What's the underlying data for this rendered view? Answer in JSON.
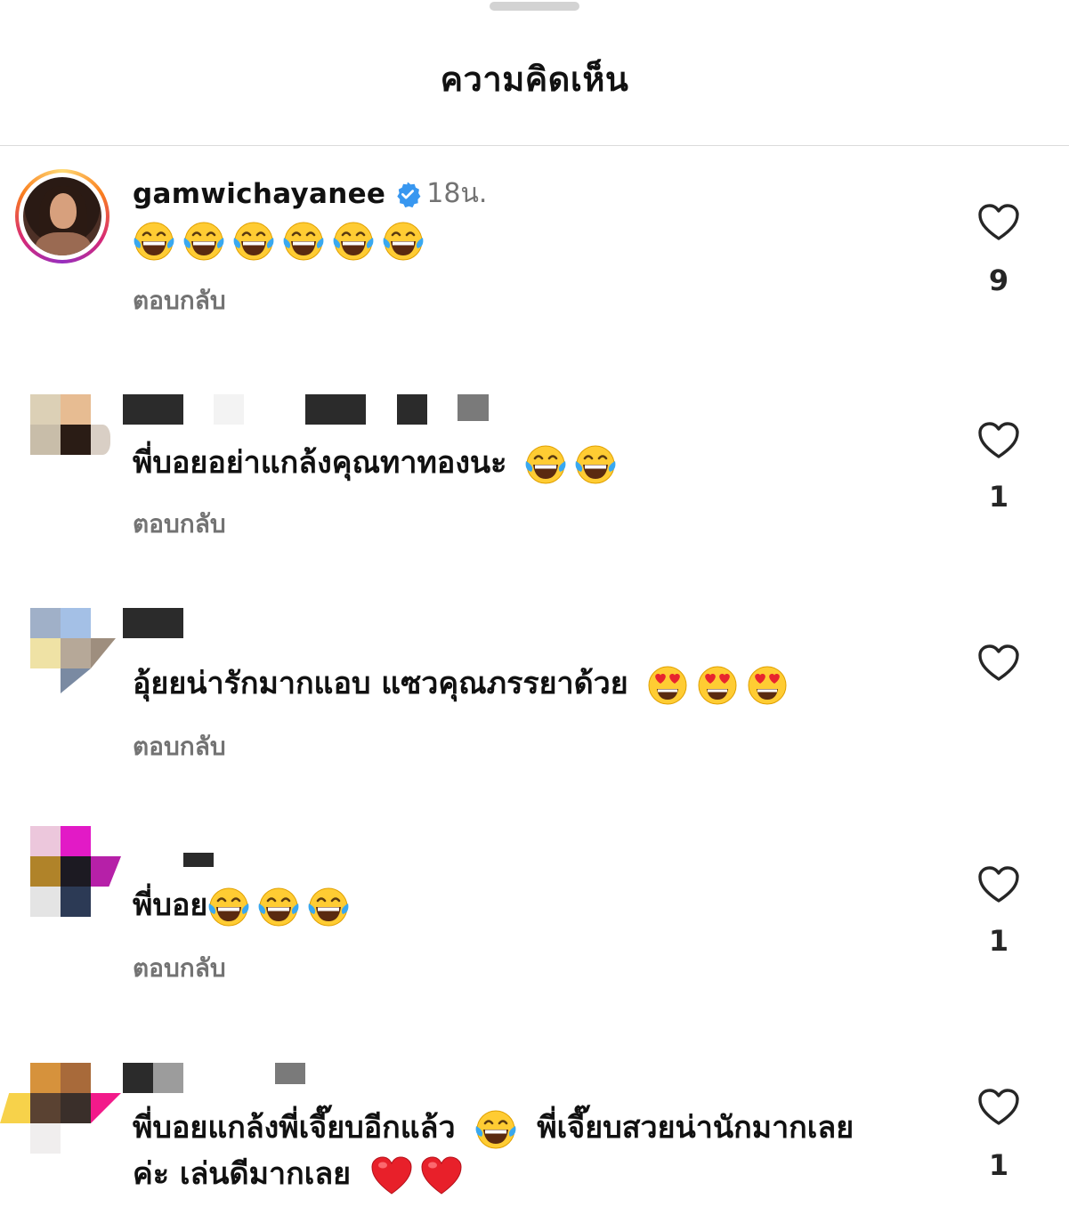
{
  "header": {
    "title": "ความคิดเห็น"
  },
  "comments": [
    {
      "username": "gamwichayanee",
      "verified": true,
      "time": "18น.",
      "text": "",
      "emojis": [
        "laugh-cry",
        "laugh-cry",
        "laugh-cry",
        "laugh-cry",
        "laugh-cry",
        "laugh-cry"
      ],
      "reply_label": "ตอบกลับ",
      "likes": "9"
    },
    {
      "username": "",
      "text": "พี่บอยอย่าแกล้งคุณทาทองนะ",
      "emojis": [
        "laugh-cry",
        "laugh-cry"
      ],
      "reply_label": "ตอบกลับ",
      "likes": "1"
    },
    {
      "username": "",
      "text": "อุ้ยยน่ารักมากแอบ แซวคุณภรรยาด้วย",
      "emojis": [
        "heart-eyes",
        "heart-eyes",
        "heart-eyes"
      ],
      "reply_label": "ตอบกลับ",
      "likes": ""
    },
    {
      "username": "",
      "text": "พี่บอย",
      "emojis": [
        "laugh-cry",
        "laugh-cry",
        "laugh-cry"
      ],
      "reply_label": "ตอบกลับ",
      "likes": "1"
    },
    {
      "username": "",
      "text_line1": "พี่บอยแกล้งพี่เจี๊ยบอีกแล้ว",
      "text_line1_tail": "พี่เจี๊ยบสวยน่านักมากเลย",
      "text_line2": "ค่ะ เล่นดีมากเลย",
      "emojis_line1": [
        "laugh-cry"
      ],
      "emojis_line2": [
        "red-heart",
        "red-heart"
      ],
      "likes": "1"
    }
  ],
  "colors": {
    "verified_blue": "#3897f0",
    "secondary_text": "#737373",
    "divider": "#dbdbdb"
  }
}
